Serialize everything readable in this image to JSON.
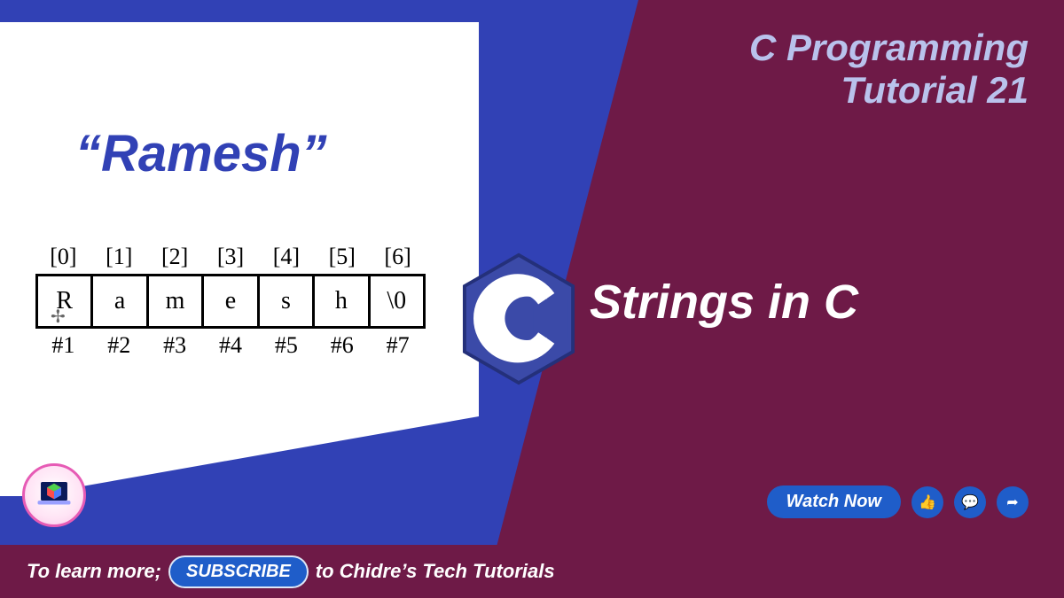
{
  "header": {
    "line1": "C Programming",
    "line2": "Tutorial 21"
  },
  "example": {
    "quoted": "“Ramesh”"
  },
  "array": {
    "indices": [
      "[0]",
      "[1]",
      "[2]",
      "[3]",
      "[4]",
      "[5]",
      "[6]"
    ],
    "chars": [
      "R",
      "a",
      "m",
      "e",
      "s",
      "h",
      "\\0"
    ],
    "positions": [
      "#1",
      "#2",
      "#3",
      "#4",
      "#5",
      "#6",
      "#7"
    ]
  },
  "logo_letter": "C",
  "subtitle": "Strings in C",
  "actions": {
    "watch": "Watch Now"
  },
  "footer": {
    "prefix": "To learn more;",
    "subscribe": "SUBSCRIBE",
    "suffix": "to Chidre’s Tech Tutorials"
  },
  "colors": {
    "maroon": "#6e1a47",
    "blue": "#3141b5",
    "button_blue": "#1f5dc9",
    "lavender": "#b9c2ec"
  }
}
